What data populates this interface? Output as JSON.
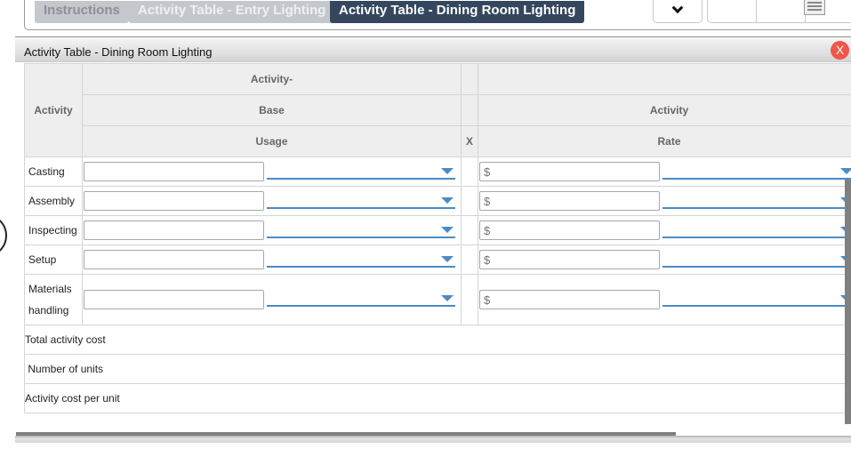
{
  "tabs": [
    {
      "label": "Instructions",
      "state": "inactive"
    },
    {
      "label": "Activity Table - Entry Lighting",
      "state": "inactive"
    },
    {
      "label": "Activity Table - Dining Room Lighting",
      "state": "active"
    }
  ],
  "toolbar": {
    "collapse_icon": "chevron-down-icon",
    "menu_icon": "hamburger-menu-icon"
  },
  "dialog": {
    "title": "Activity Table - Dining Room Lighting",
    "close_label": "X"
  },
  "table": {
    "headers": {
      "activity": "Activity",
      "base_line1": "Activity-",
      "base_line2": "Base",
      "base_line3": "Usage",
      "multiply": "X",
      "rate_line1": "",
      "rate_line2": "Activity",
      "rate_line3": "Rate"
    },
    "rows": [
      {
        "label": "Casting",
        "usage_value": "",
        "usage_unit": "",
        "rate_value": "",
        "rate_placeholder": "$",
        "rate_unit": ""
      },
      {
        "label": "Assembly",
        "usage_value": "",
        "usage_unit": "",
        "rate_value": "",
        "rate_placeholder": "$",
        "rate_unit": ""
      },
      {
        "label": "Inspecting",
        "usage_value": "",
        "usage_unit": "",
        "rate_value": "",
        "rate_placeholder": "$",
        "rate_unit": ""
      },
      {
        "label": "Setup",
        "usage_value": "",
        "usage_unit": "",
        "rate_value": "",
        "rate_placeholder": "$",
        "rate_unit": ""
      },
      {
        "label_line1": "Materials",
        "label_line2": "handling",
        "usage_value": "",
        "usage_unit": "",
        "rate_value": "",
        "rate_placeholder": "$",
        "rate_unit": ""
      }
    ],
    "summary": [
      {
        "label": "Total activity cost"
      },
      {
        "label": " Number of units"
      },
      {
        "label": "Activity cost per unit"
      }
    ]
  },
  "colors": {
    "active_tab": "#34475e",
    "inactive_tab": "#c4c8cc",
    "dropdown_accent": "#4c8cc4",
    "close_button": "#f0564a"
  }
}
